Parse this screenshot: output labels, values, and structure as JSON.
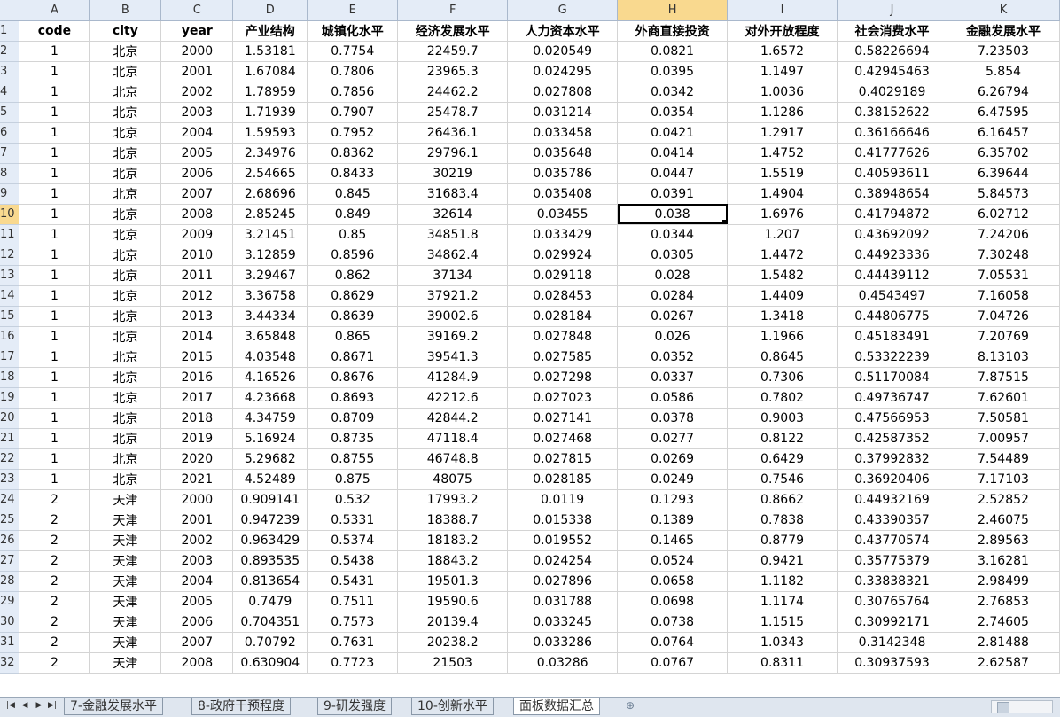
{
  "columns": [
    "A",
    "B",
    "C",
    "D",
    "E",
    "F",
    "G",
    "H",
    "I",
    "J",
    "K"
  ],
  "selected_column": "H",
  "selected_row": 10,
  "header_row": {
    "row": 1,
    "cells": [
      "code",
      "city",
      "year",
      "产业结构",
      "城镇化水平",
      "经济发展水平",
      "人力资本水平",
      "外商直接投资",
      "对外开放程度",
      "社会消费水平",
      "金融发展水平"
    ]
  },
  "rows": [
    {
      "row": 2,
      "cells": [
        "1",
        "北京",
        "2000",
        "1.53181",
        "0.7754",
        "22459.7",
        "0.020549",
        "0.0821",
        "1.6572",
        "0.58226694",
        "7.23503"
      ]
    },
    {
      "row": 3,
      "cells": [
        "1",
        "北京",
        "2001",
        "1.67084",
        "0.7806",
        "23965.3",
        "0.024295",
        "0.0395",
        "1.1497",
        "0.42945463",
        "5.854"
      ]
    },
    {
      "row": 4,
      "cells": [
        "1",
        "北京",
        "2002",
        "1.78959",
        "0.7856",
        "24462.2",
        "0.027808",
        "0.0342",
        "1.0036",
        "0.4029189",
        "6.26794"
      ]
    },
    {
      "row": 5,
      "cells": [
        "1",
        "北京",
        "2003",
        "1.71939",
        "0.7907",
        "25478.7",
        "0.031214",
        "0.0354",
        "1.1286",
        "0.38152622",
        "6.47595"
      ]
    },
    {
      "row": 6,
      "cells": [
        "1",
        "北京",
        "2004",
        "1.59593",
        "0.7952",
        "26436.1",
        "0.033458",
        "0.0421",
        "1.2917",
        "0.36166646",
        "6.16457"
      ]
    },
    {
      "row": 7,
      "cells": [
        "1",
        "北京",
        "2005",
        "2.34976",
        "0.8362",
        "29796.1",
        "0.035648",
        "0.0414",
        "1.4752",
        "0.41777626",
        "6.35702"
      ]
    },
    {
      "row": 8,
      "cells": [
        "1",
        "北京",
        "2006",
        "2.54665",
        "0.8433",
        "30219",
        "0.035786",
        "0.0447",
        "1.5519",
        "0.40593611",
        "6.39644"
      ]
    },
    {
      "row": 9,
      "cells": [
        "1",
        "北京",
        "2007",
        "2.68696",
        "0.845",
        "31683.4",
        "0.035408",
        "0.0391",
        "1.4904",
        "0.38948654",
        "5.84573"
      ]
    },
    {
      "row": 10,
      "cells": [
        "1",
        "北京",
        "2008",
        "2.85245",
        "0.849",
        "32614",
        "0.03455",
        "0.038",
        "1.6976",
        "0.41794872",
        "6.02712"
      ]
    },
    {
      "row": 11,
      "cells": [
        "1",
        "北京",
        "2009",
        "3.21451",
        "0.85",
        "34851.8",
        "0.033429",
        "0.0344",
        "1.207",
        "0.43692092",
        "7.24206"
      ]
    },
    {
      "row": 12,
      "cells": [
        "1",
        "北京",
        "2010",
        "3.12859",
        "0.8596",
        "34862.4",
        "0.029924",
        "0.0305",
        "1.4472",
        "0.44923336",
        "7.30248"
      ]
    },
    {
      "row": 13,
      "cells": [
        "1",
        "北京",
        "2011",
        "3.29467",
        "0.862",
        "37134",
        "0.029118",
        "0.028",
        "1.5482",
        "0.44439112",
        "7.05531"
      ]
    },
    {
      "row": 14,
      "cells": [
        "1",
        "北京",
        "2012",
        "3.36758",
        "0.8629",
        "37921.2",
        "0.028453",
        "0.0284",
        "1.4409",
        "0.4543497",
        "7.16058"
      ]
    },
    {
      "row": 15,
      "cells": [
        "1",
        "北京",
        "2013",
        "3.44334",
        "0.8639",
        "39002.6",
        "0.028184",
        "0.0267",
        "1.3418",
        "0.44806775",
        "7.04726"
      ]
    },
    {
      "row": 16,
      "cells": [
        "1",
        "北京",
        "2014",
        "3.65848",
        "0.865",
        "39169.2",
        "0.027848",
        "0.026",
        "1.1966",
        "0.45183491",
        "7.20769"
      ]
    },
    {
      "row": 17,
      "cells": [
        "1",
        "北京",
        "2015",
        "4.03548",
        "0.8671",
        "39541.3",
        "0.027585",
        "0.0352",
        "0.8645",
        "0.53322239",
        "8.13103"
      ]
    },
    {
      "row": 18,
      "cells": [
        "1",
        "北京",
        "2016",
        "4.16526",
        "0.8676",
        "41284.9",
        "0.027298",
        "0.0337",
        "0.7306",
        "0.51170084",
        "7.87515"
      ]
    },
    {
      "row": 19,
      "cells": [
        "1",
        "北京",
        "2017",
        "4.23668",
        "0.8693",
        "42212.6",
        "0.027023",
        "0.0586",
        "0.7802",
        "0.49736747",
        "7.62601"
      ]
    },
    {
      "row": 20,
      "cells": [
        "1",
        "北京",
        "2018",
        "4.34759",
        "0.8709",
        "42844.2",
        "0.027141",
        "0.0378",
        "0.9003",
        "0.47566953",
        "7.50581"
      ]
    },
    {
      "row": 21,
      "cells": [
        "1",
        "北京",
        "2019",
        "5.16924",
        "0.8735",
        "47118.4",
        "0.027468",
        "0.0277",
        "0.8122",
        "0.42587352",
        "7.00957"
      ]
    },
    {
      "row": 22,
      "cells": [
        "1",
        "北京",
        "2020",
        "5.29682",
        "0.8755",
        "46748.8",
        "0.027815",
        "0.0269",
        "0.6429",
        "0.37992832",
        "7.54489"
      ]
    },
    {
      "row": 23,
      "cells": [
        "1",
        "北京",
        "2021",
        "4.52489",
        "0.875",
        "48075",
        "0.028185",
        "0.0249",
        "0.7546",
        "0.36920406",
        "7.17103"
      ]
    },
    {
      "row": 24,
      "cells": [
        "2",
        "天津",
        "2000",
        "0.909141",
        "0.532",
        "17993.2",
        "0.0119",
        "0.1293",
        "0.8662",
        "0.44932169",
        "2.52852"
      ]
    },
    {
      "row": 25,
      "cells": [
        "2",
        "天津",
        "2001",
        "0.947239",
        "0.5331",
        "18388.7",
        "0.015338",
        "0.1389",
        "0.7838",
        "0.43390357",
        "2.46075"
      ]
    },
    {
      "row": 26,
      "cells": [
        "2",
        "天津",
        "2002",
        "0.963429",
        "0.5374",
        "18183.2",
        "0.019552",
        "0.1465",
        "0.8779",
        "0.43770574",
        "2.89563"
      ]
    },
    {
      "row": 27,
      "cells": [
        "2",
        "天津",
        "2003",
        "0.893535",
        "0.5438",
        "18843.2",
        "0.024254",
        "0.0524",
        "0.9421",
        "0.35775379",
        "3.16281"
      ]
    },
    {
      "row": 28,
      "cells": [
        "2",
        "天津",
        "2004",
        "0.813654",
        "0.5431",
        "19501.3",
        "0.027896",
        "0.0658",
        "1.1182",
        "0.33838321",
        "2.98499"
      ]
    },
    {
      "row": 29,
      "cells": [
        "2",
        "天津",
        "2005",
        "0.7479",
        "0.7511",
        "19590.6",
        "0.031788",
        "0.0698",
        "1.1174",
        "0.30765764",
        "2.76853"
      ]
    },
    {
      "row": 30,
      "cells": [
        "2",
        "天津",
        "2006",
        "0.704351",
        "0.7573",
        "20139.4",
        "0.033245",
        "0.0738",
        "1.1515",
        "0.30992171",
        "2.74605"
      ]
    },
    {
      "row": 31,
      "cells": [
        "2",
        "天津",
        "2007",
        "0.70792",
        "0.7631",
        "20238.2",
        "0.033286",
        "0.0764",
        "1.0343",
        "0.3142348",
        "2.81488"
      ]
    },
    {
      "row": 32,
      "cells": [
        "2",
        "天津",
        "2008",
        "0.630904",
        "0.7723",
        "21503",
        "0.03286",
        "0.0767",
        "0.8311",
        "0.30937593",
        "2.62587"
      ]
    }
  ],
  "sheet_tabs": [
    "7-金融发展水平",
    "8-政府干预程度",
    "9-研发强度",
    "10-创新水平",
    "面板数据汇总"
  ],
  "active_tab": "面板数据汇总",
  "icons": {
    "nav_first": "nav-first-icon",
    "nav_prev": "nav-prev-icon",
    "nav_next": "nav-next-icon",
    "nav_last": "nav-last-icon",
    "new_sheet": "new-sheet-icon"
  }
}
